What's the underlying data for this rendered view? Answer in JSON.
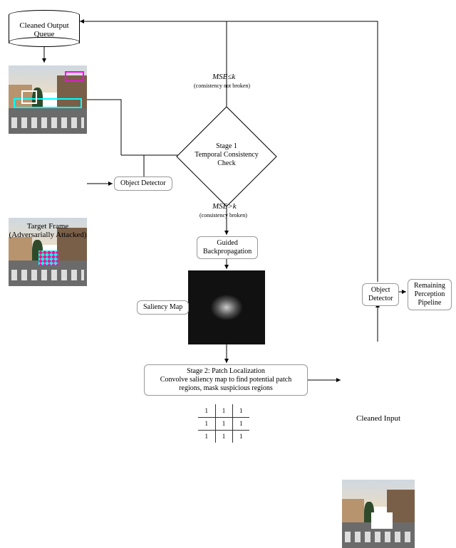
{
  "queue_label": "Cleaned Output\nQueue",
  "target_frame_label": "Target Frame\n(Adversarially Attacked)",
  "object_detector_label": "Object\nDetector",
  "stage1_label": "Stage 1\nTemporal Consistency\nCheck",
  "mse_le": "MSE≤k",
  "mse_le_note": "(consistency not broken)",
  "mse_gt": "MSE>k",
  "mse_gt_note": "(consistency broken)",
  "guided_bp_label": "Guided\nBackpropagation",
  "saliency_label": "Saliency Map",
  "stage2_label": "Stage 2: Patch Localization\nConvolve saliency map to find potential patch\nregions, mask suspicious regions",
  "cleaned_input_label": "Cleaned Input",
  "remaining_label": "Remaining\nPerception\nPipeline",
  "matrix": [
    [
      1,
      1,
      1
    ],
    [
      1,
      1,
      1
    ],
    [
      1,
      1,
      1
    ]
  ]
}
